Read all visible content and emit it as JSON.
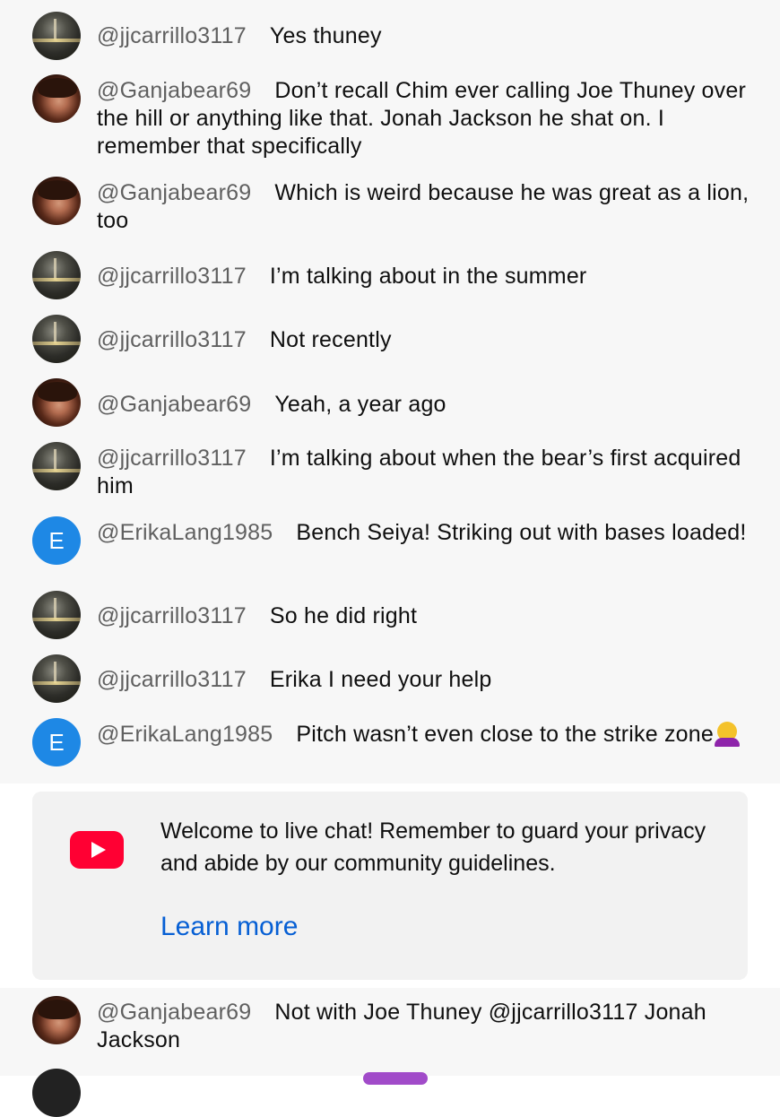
{
  "messages": [
    {
      "author": "@jjcarrillo3117",
      "text": "Yes thuney",
      "avatar": "night-photo"
    },
    {
      "author": "@Ganjabear69",
      "text": "Don’t recall Chim ever calling Joe Thuney over the hill or anything like that. Jonah Jackson he shat on. I remember that specifically",
      "avatar": "face-photo"
    },
    {
      "author": "@Ganjabear69",
      "text": "Which is weird because he was great as a lion, too",
      "avatar": "face-photo"
    },
    {
      "author": "@jjcarrillo3117",
      "text": "I’m talking about in the summer",
      "avatar": "night-photo"
    },
    {
      "author": "@jjcarrillo3117",
      "text": "Not recently",
      "avatar": "night-photo"
    },
    {
      "author": "@Ganjabear69",
      "text": "Yeah, a year ago",
      "avatar": "face-photo"
    },
    {
      "author": "@jjcarrillo3117",
      "text": "I’m talking about when the bear’s first acquired him",
      "avatar": "night-photo"
    },
    {
      "author": "@ErikaLang1985",
      "text": "Bench Seiya! Striking out with bases loaded!",
      "avatar": "letter",
      "avatar_letter": "E"
    },
    {
      "author": "@jjcarrillo3117",
      "text": "So he did right",
      "avatar": "night-photo"
    },
    {
      "author": "@jjcarrillo3117",
      "text": "Erika I need your help",
      "avatar": "night-photo"
    },
    {
      "author": "@ErikaLang1985",
      "text": "Pitch wasn’t even close to the strike zone",
      "avatar": "letter",
      "avatar_letter": "E",
      "emoji": "woman-facepalming-emoji"
    },
    {
      "author": "@Ganjabear69",
      "text": "Not with Joe Thuney @jjcarrillo3117 Jonah Jackson",
      "avatar": "face-photo"
    }
  ],
  "welcome_banner": {
    "icon": "youtube-play-icon",
    "text": "Welcome to live chat! Remember to guard your privacy and abide by our community guidelines.",
    "link_label": "Learn more"
  },
  "colors": {
    "chat_background": "#f7f7f7",
    "banner_background": "#f2f2f2",
    "author": "#606060",
    "link": "#065fd4",
    "youtube_red": "#ff0033",
    "letter_avatar": "#1e88e5"
  }
}
